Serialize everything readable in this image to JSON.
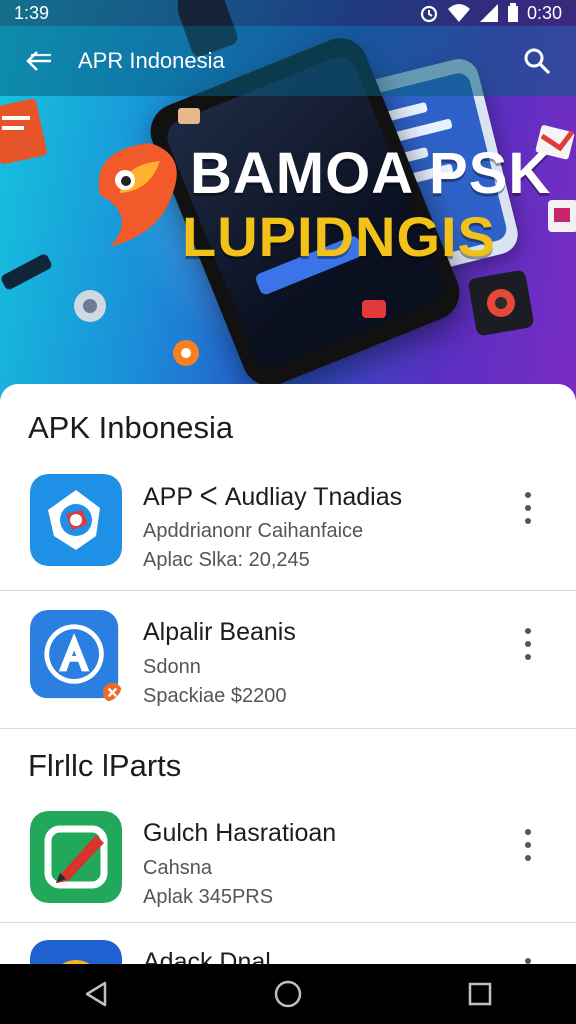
{
  "status_bar": {
    "time": "1:39",
    "right_time": "0:30",
    "icons": [
      "alarm-icon",
      "wifi-icon",
      "signal-icon",
      "battery-icon"
    ]
  },
  "app_bar": {
    "title": "APR Indonesia",
    "back_icon": "back-arrow-icon",
    "search_icon": "search-icon"
  },
  "banner": {
    "line1": "BAMOA PSK",
    "line2": "LUPIDNGIS",
    "colors": {
      "line1": "#ffffff",
      "line2": "#f2c21b"
    }
  },
  "sections": [
    {
      "title": "APK Inbonesia",
      "items": [
        {
          "name": "APP ᐸ Audliay Tnadias",
          "line1": "Apddrianonr Caihanfaice",
          "line2": "Aplac Slka: 20,245",
          "icon": "compass-app-icon",
          "icon_color": "#1e90e6"
        },
        {
          "name": "Alpalir Beanis",
          "line1": "Sdonn",
          "line2": "Spackiae $2200",
          "icon": "letter-a-app-icon",
          "icon_color": "#2a7fe0"
        }
      ]
    },
    {
      "title": "Flrllc lParts",
      "items": [
        {
          "name": "Gulch Hasratioan",
          "line1": "Cahsna",
          "line2": "Aplak 345PRS",
          "icon": "pen-app-icon",
          "icon_color": "#22a85a"
        },
        {
          "name": "Adack Dnal",
          "line1": "",
          "line2": "",
          "icon": "browser-app-icon",
          "icon_color": "#2060d0"
        }
      ]
    }
  ],
  "nav_bar": {
    "buttons": [
      "back-nav-icon",
      "home-nav-icon",
      "recents-nav-icon"
    ]
  }
}
